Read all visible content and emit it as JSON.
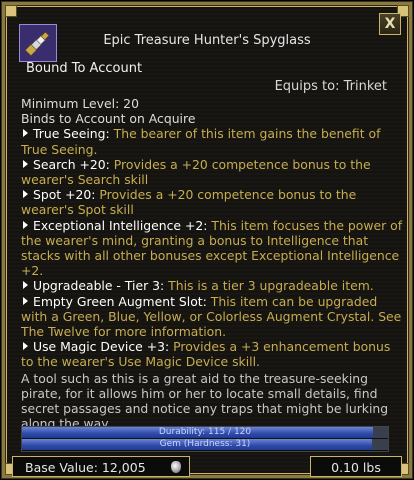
{
  "window": {
    "close_label": "X"
  },
  "item": {
    "name": "Epic Treasure Hunter's Spyglass",
    "bound": "Bound To Account",
    "equips": "Equips to: Trinket",
    "min_level": "Minimum Level: 20",
    "binds": "Binds to Account on Acquire",
    "effects": [
      {
        "name": "True Seeing:",
        "desc": " The bearer of this item gains the benefit of True Seeing."
      },
      {
        "name": "Search +20:",
        "desc": " Provides a +20 competence bonus to the wearer's Search skill"
      },
      {
        "name": "Spot +20:",
        "desc": " Provides a +20 competence bonus to the wearer's Spot skill"
      },
      {
        "name": "Exceptional Intelligence +2:",
        "desc": " This item focuses the power of the wearer's mind, granting a bonus to Intelligence that stacks with all other bonuses except Exceptional Intelligence +2."
      },
      {
        "name": "Upgradeable - Tier 3:",
        "desc": " This is a tier 3 upgradeable item."
      },
      {
        "name": "Empty Green Augment Slot:",
        "desc": " This item can be upgraded with a Green, Blue, Yellow, or Colorless Augment Crystal. See The Twelve for more information."
      },
      {
        "name": "Use Magic Device +3:",
        "desc": " Provides a +3 enhancement bonus to the wearer's Use Magic Device skill."
      }
    ],
    "flavor": "A tool such as this is a great aid to the treasure-seeking pirate, for it allows him or her to locate small details, find secret passages and notice any traps that might be lurking along the way.",
    "durability": {
      "label": "Durability: 115 / 120",
      "current": 115,
      "max": 120
    },
    "gem": "Gem (Hardness: 31)",
    "base_value": "Base Value: 12,005",
    "weight": "0.10 lbs"
  },
  "colors": {
    "frame_gold": "#c9b46a",
    "effect_gold": "#c7ad50",
    "bar_blue": "#2f4aa8",
    "icon_bg": "#3a2d6e"
  },
  "icons": {
    "item": "spyglass-icon",
    "base_value": "gem-currency-icon",
    "bullet": "triangle-bullet-icon"
  }
}
